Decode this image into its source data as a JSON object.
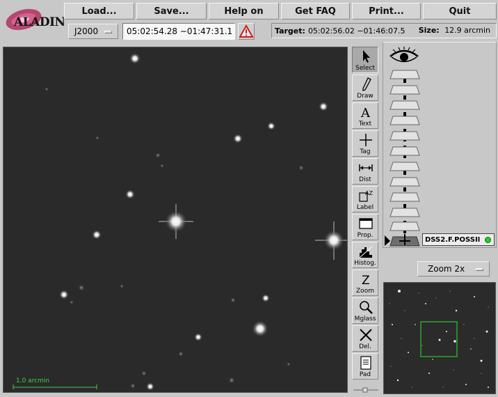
{
  "app": {
    "logo_text": "ALADIN"
  },
  "menu": [
    {
      "key": "load",
      "label": "Load..."
    },
    {
      "key": "save",
      "label": "Save..."
    },
    {
      "key": "help",
      "label": "Help on"
    },
    {
      "key": "faq",
      "label": "Get FAQ"
    },
    {
      "key": "print",
      "label": "Print..."
    },
    {
      "key": "quit",
      "label": "Quit"
    }
  ],
  "frame": {
    "value": "J2000"
  },
  "location": {
    "value": "05:02:54.28 −01:47:31.1",
    "warning_icon": "warning-triangle"
  },
  "target": {
    "label": "Target:",
    "value": "05:02:56.02 −01:46:07.5",
    "size_label": "Size:",
    "size_value": "12.9 arcmin"
  },
  "view": {
    "scale_label": "1.0 arcmin",
    "scale_color": "#46d046"
  },
  "tools": [
    {
      "key": "select",
      "label": "Select",
      "icon": "arrow-pointer-icon",
      "active": true
    },
    {
      "key": "draw",
      "label": "Draw",
      "icon": "pencil-icon",
      "active": false
    },
    {
      "key": "text",
      "label": "Text",
      "icon": "letter-a-icon",
      "active": false
    },
    {
      "key": "tag",
      "label": "Tag",
      "icon": "crosshair-icon",
      "active": false
    },
    {
      "key": "dist",
      "label": "Dist",
      "icon": "distance-arrow-icon",
      "active": false
    },
    {
      "key": "label",
      "label": "Label",
      "icon": "label-az-icon",
      "active": false
    },
    {
      "key": "prop",
      "label": "Prop.",
      "icon": "properties-window-icon",
      "active": false
    },
    {
      "key": "histog",
      "label": "Histog.",
      "icon": "histogram-icon",
      "active": false
    },
    {
      "key": "zoom",
      "label": "Zoom",
      "icon": "letter-z-icon",
      "active": false
    },
    {
      "key": "mglass",
      "label": "Mglass",
      "icon": "magnifier-icon",
      "active": false
    },
    {
      "key": "del",
      "label": "Del.",
      "icon": "x-delete-icon",
      "active": false
    },
    {
      "key": "pad",
      "label": "Pad",
      "icon": "notepad-icon",
      "active": false
    }
  ],
  "layers": {
    "survey_label": "DSS2.F.POSSII",
    "status_color": "#20d020"
  },
  "zoom": {
    "value": "Zoom 2x"
  }
}
